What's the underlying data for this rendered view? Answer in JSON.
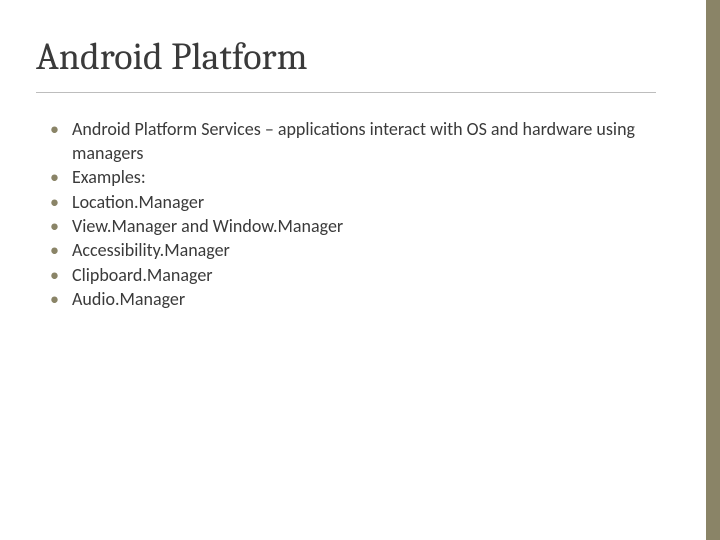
{
  "slide": {
    "title": "Android Platform",
    "bullets": [
      "Android Platform Services – applications interact with OS and hardware using managers",
      "Examples:",
      "Location.Manager",
      "View.Manager and Window.Manager",
      "Accessibility.Manager",
      "Clipboard.Manager",
      "Audio.Manager"
    ]
  },
  "theme": {
    "accent": "#8a8467"
  }
}
